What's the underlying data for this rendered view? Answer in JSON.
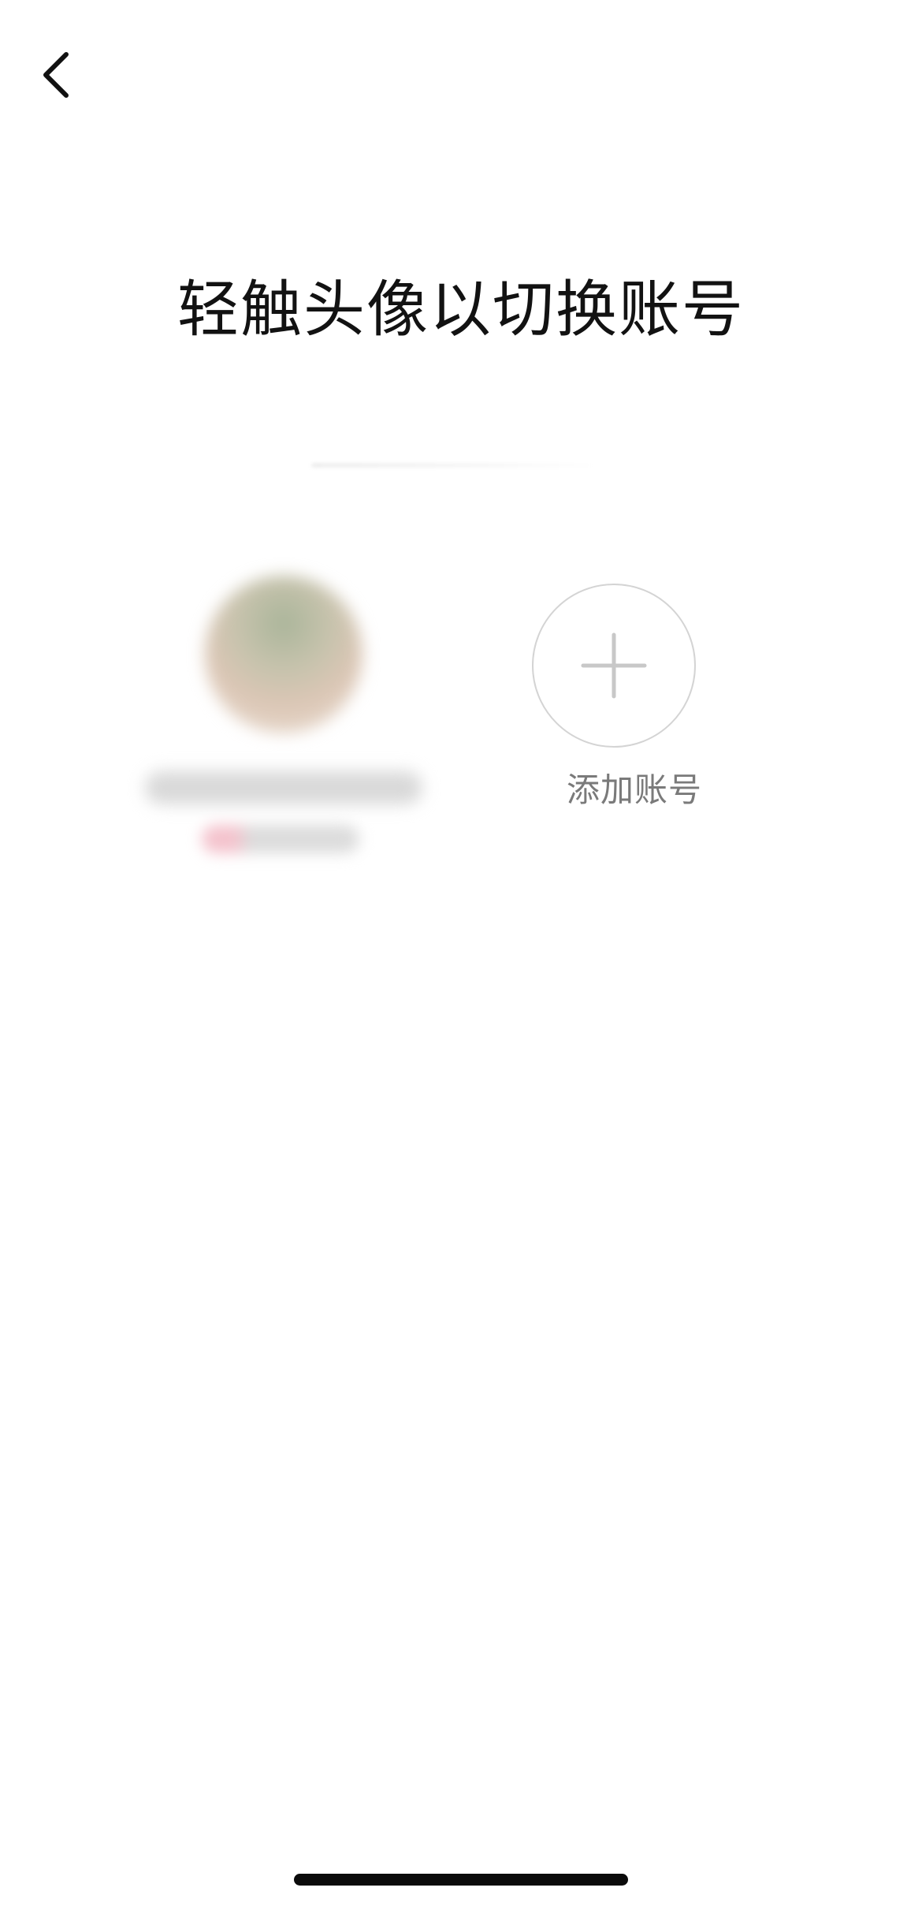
{
  "header": {
    "back_icon": "chevron-left-icon"
  },
  "page": {
    "title": "轻触头像以切换账号"
  },
  "accounts": [
    {
      "avatar_icon": "avatar",
      "name": "",
      "subtitle": ""
    }
  ],
  "add_account": {
    "icon": "plus-icon",
    "label": "添加账号"
  },
  "colors": {
    "background": "#ffffff",
    "title_text": "#121212",
    "secondary_text": "#7a7a7a",
    "circle_border": "#d4d4d4",
    "plus_icon": "#c8c8c8",
    "home_indicator": "#0b0b0b"
  }
}
